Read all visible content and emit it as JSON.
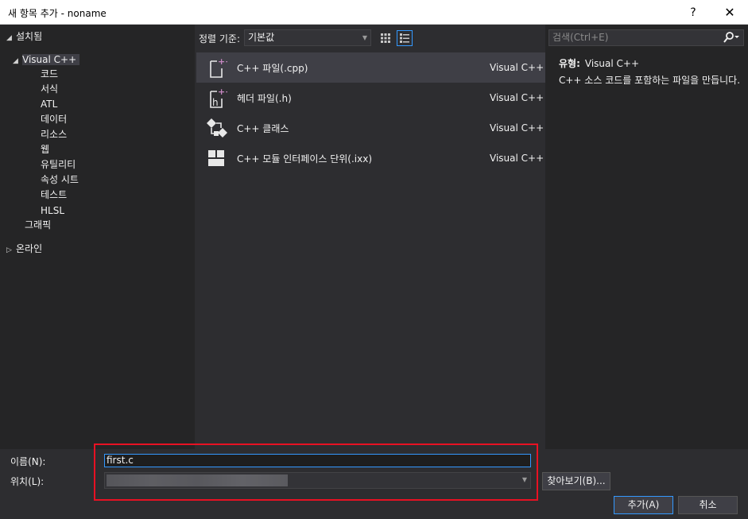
{
  "window": {
    "title": "새 항목 추가 - noname",
    "help": "?",
    "close": "✕"
  },
  "tree": {
    "installed": "설치됨",
    "visualcpp": "Visual C++",
    "children": [
      "코드",
      "서식",
      "ATL",
      "데이터",
      "리소스",
      "웹",
      "유틸리티",
      "속성 시트",
      "테스트",
      "HLSL"
    ],
    "graphics": "그래픽",
    "online": "온라인"
  },
  "toolbar": {
    "sort_label": "정렬 기준:",
    "sort_value": "기본값"
  },
  "templates": [
    {
      "name": "C++ 파일(.cpp)",
      "lang": "Visual C++",
      "icon": "cpp-file-icon"
    },
    {
      "name": "헤더 파일(.h)",
      "lang": "Visual C++",
      "icon": "header-file-icon"
    },
    {
      "name": "C++ 클래스",
      "lang": "Visual C++",
      "icon": "class-icon"
    },
    {
      "name": "C++ 모듈 인터페이스 단위(.ixx)",
      "lang": "Visual C++",
      "icon": "module-icon"
    }
  ],
  "details": {
    "search_placeholder": "검색(Ctrl+E)",
    "type_label": "유형:",
    "type_value": "Visual C++",
    "description": "C++ 소스 코드를 포함하는 파일을 만듭니다."
  },
  "form": {
    "name_label": "이름(N):",
    "name_value": "first.c",
    "location_label": "위치(L):",
    "browse": "찾아보기(B)...",
    "add": "추가(A)",
    "cancel": "취소"
  },
  "colors": {
    "accent": "#3399ff",
    "highlight": "#e81123",
    "file_icon": "#c586c0"
  }
}
